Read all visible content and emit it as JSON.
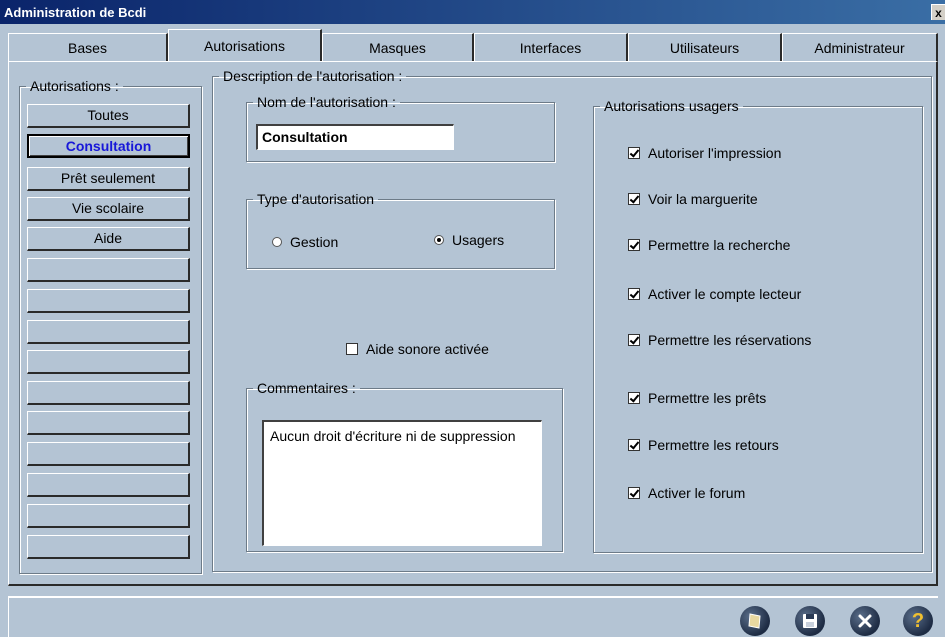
{
  "window": {
    "title": "Administration de Bcdi",
    "close_label": "x"
  },
  "tabs": [
    {
      "label": "Bases"
    },
    {
      "label": "Autorisations"
    },
    {
      "label": "Masques"
    },
    {
      "label": "Interfaces"
    },
    {
      "label": "Utilisateurs"
    },
    {
      "label": "Administrateur"
    }
  ],
  "active_tab": "Autorisations",
  "left_panel": {
    "legend": "Autorisations :",
    "items": [
      "Toutes",
      "Consultation",
      "Prêt seulement",
      "Vie scolaire",
      "Aide",
      "",
      "",
      "",
      "",
      "",
      "",
      "",
      "",
      "",
      ""
    ],
    "selected": "Consultation"
  },
  "description": {
    "legend": "Description de l'autorisation :",
    "name_group": {
      "legend": "Nom de l'autorisation :",
      "value": "Consultation"
    },
    "type_group": {
      "legend": "Type d'autorisation",
      "options": [
        {
          "label": "Gestion",
          "checked": false
        },
        {
          "label": "Usagers",
          "checked": true
        }
      ]
    },
    "sound": {
      "label": "Aide sonore activée",
      "checked": false
    },
    "comments": {
      "legend": "Commentaires :",
      "text": "Aucun droit d'écriture ni de suppression"
    },
    "user_rights": {
      "legend": "Autorisations usagers",
      "items": [
        {
          "label": "Autoriser l'impression",
          "checked": true
        },
        {
          "label": "Voir la marguerite",
          "checked": true
        },
        {
          "label": "Permettre la recherche",
          "checked": true
        },
        {
          "label": "Activer le compte lecteur",
          "checked": true
        },
        {
          "label": "Permettre les réservations",
          "checked": true
        },
        {
          "label": "Permettre les prêts",
          "checked": true
        },
        {
          "label": "Permettre les retours",
          "checked": true
        },
        {
          "label": "Activer le forum",
          "checked": true
        }
      ]
    }
  },
  "footer_buttons": [
    {
      "icon": "document-icon"
    },
    {
      "icon": "save-icon"
    },
    {
      "icon": "close-icon"
    },
    {
      "icon": "help-icon",
      "label": "?"
    }
  ],
  "colors": {
    "background": "#b4c4d4",
    "selected_text": "#1818d8",
    "titlebar": "#0a246a"
  }
}
